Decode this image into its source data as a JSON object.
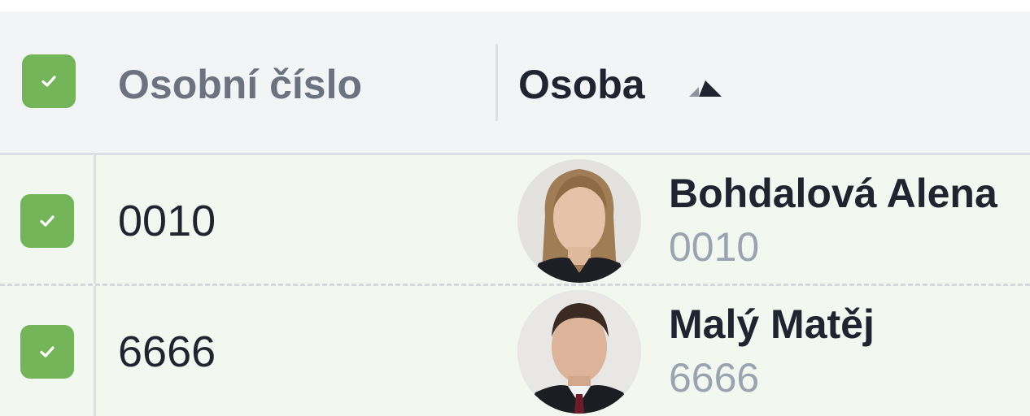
{
  "header": {
    "col_personal_number": "Osobní číslo",
    "col_person": "Osoba",
    "select_all_checked": true
  },
  "rows": [
    {
      "checked": true,
      "personal_number": "0010",
      "name": "Bohdalová Alena",
      "code": "0010"
    },
    {
      "checked": true,
      "personal_number": "6666",
      "name": "Malý Matěj",
      "code": "6666"
    }
  ],
  "colors": {
    "checkbox": "#74b55a",
    "row_selected_bg": "#f2f7ef",
    "header_bg": "#f3f4f6"
  },
  "icons": {
    "sort": "sort-ascending-icon",
    "check": "checkmark-icon"
  }
}
